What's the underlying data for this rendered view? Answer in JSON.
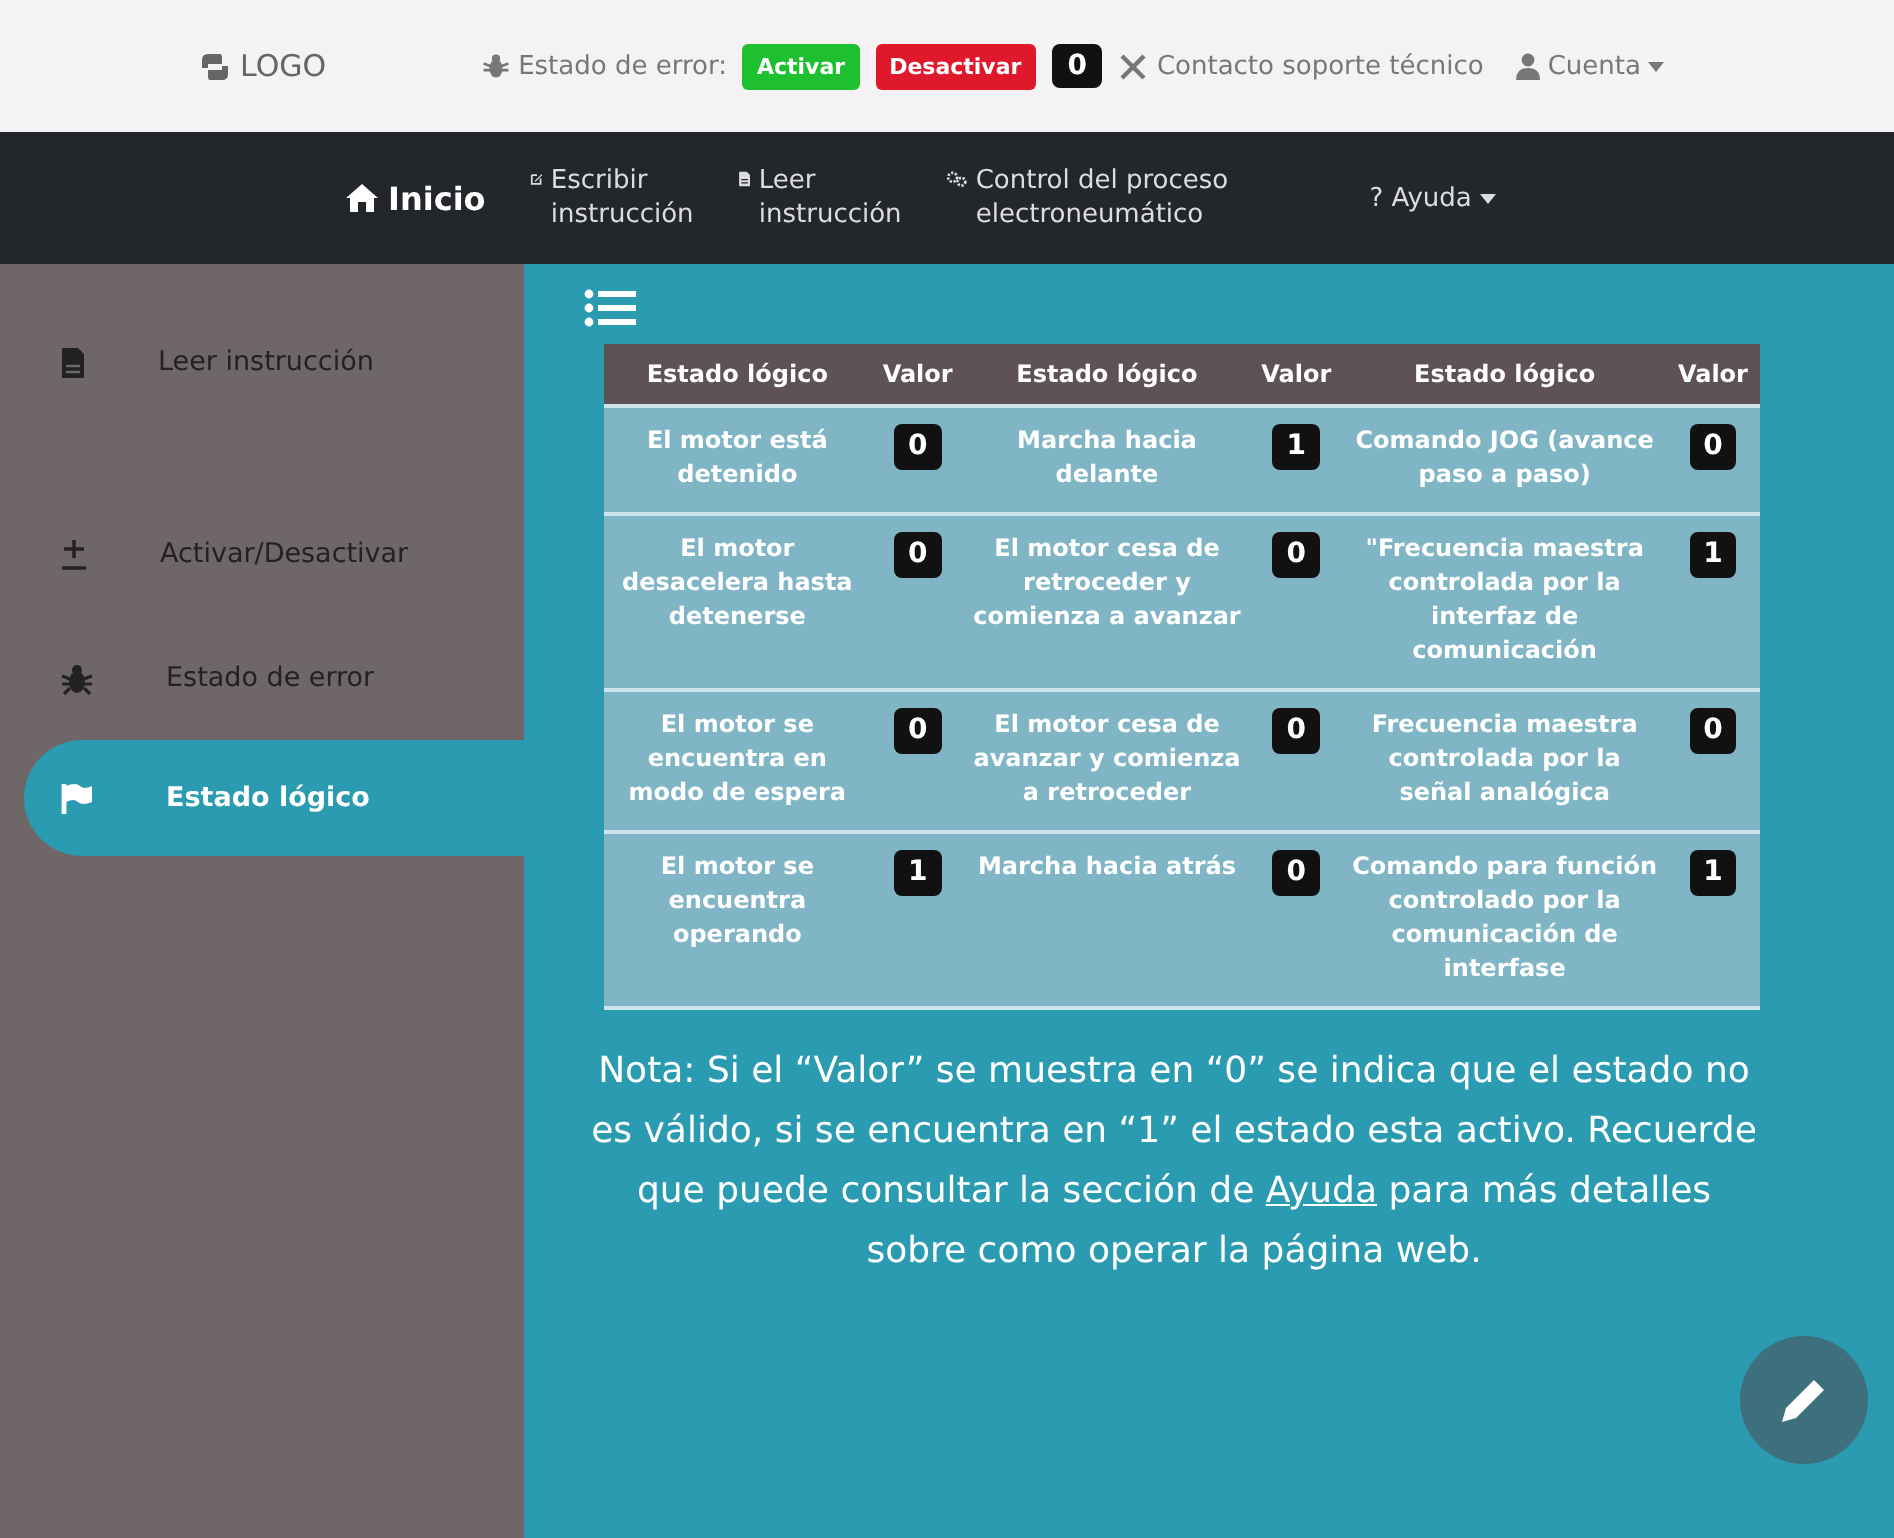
{
  "topbar": {
    "logo": "LOGO",
    "error_label": "Estado de error:",
    "activate_button": "Activar",
    "deactivate_button": "Desactivar",
    "error_count": "0",
    "support_link": "Contacto soporte técnico",
    "account_menu": "Cuenta"
  },
  "nav": [
    {
      "label": "Inicio",
      "selected": true
    },
    {
      "label": "Escribir instrucción",
      "selected": false
    },
    {
      "label": "Leer instrucción",
      "selected": false
    },
    {
      "label": "Control del proceso electroneumático",
      "selected": false
    },
    {
      "label": "Ayuda",
      "icon_glyph": "?",
      "selected": false
    }
  ],
  "sidebar": {
    "items": [
      {
        "label": "Leer instrucción",
        "selected": false
      },
      {
        "label": "Activar/Desactivar",
        "selected": false
      },
      {
        "label": "Estado de error",
        "selected": false
      },
      {
        "label": "Estado lógico",
        "selected": true
      }
    ]
  },
  "table": {
    "columns": [
      "Estado lógico",
      "Valor",
      "Estado lógico",
      "Valor",
      "Estado lógico",
      "Valor"
    ],
    "rows": [
      [
        "El motor está detenido",
        "0",
        "Marcha hacia delante",
        "1",
        "Comando JOG (avance paso a paso)",
        "0"
      ],
      [
        "El motor desacelera hasta detenerse",
        "0",
        "El motor cesa de retroceder y comienza a avanzar",
        "0",
        "\"Frecuencia maestra controlada por la interfaz de comunicación",
        "1"
      ],
      [
        "El motor se encuentra en modo de espera",
        "0",
        "El motor cesa de avanzar y comienza a retroceder",
        "0",
        "Frecuencia maestra controlada por la señal analógica",
        "0"
      ],
      [
        "El motor se encuentra operando",
        "1",
        "Marcha hacia atrás",
        "0",
        "Comando para función controlado por la comunicación de interfase",
        "1"
      ]
    ]
  },
  "note": {
    "text_before": "Nota: Si el “Valor” se muestra en “0” se indica que el estado no es válido, si se encuentra en “1” el estado esta activo. Recuerde que puede consultar la sección de",
    "link": "Ayuda",
    "text_after": "para más detalles sobre como operar la página web."
  }
}
